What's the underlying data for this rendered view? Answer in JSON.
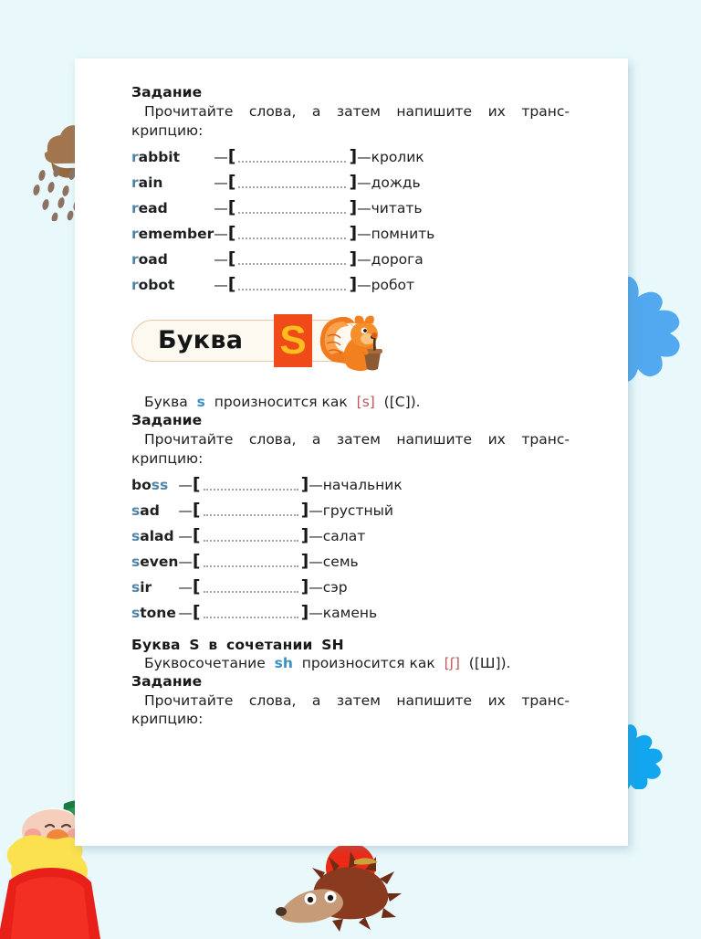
{
  "page": {
    "background_color": "#e8f8fb",
    "sheet_color": "#ffffff"
  },
  "colors": {
    "highlight_blue": "#4d84a8",
    "prose_blue": "#3c91c4",
    "ipa_red": "#c0575b",
    "chip_orange": "#ef4a18",
    "chip_letter": "#fbbe1e",
    "banner_fill": "#fdf9f0",
    "banner_border": "#e6c9a8"
  },
  "section_r": {
    "task_heading": "Задание",
    "instruction_line1": "Прочитайте слова, а затем напишите их транс-",
    "instruction_line2": "крипцию:",
    "words": [
      {
        "prefix": "r",
        "rest": "abbit",
        "dash": "—",
        "blank": "",
        "dash2": "—",
        "translation": "кролик"
      },
      {
        "prefix": "r",
        "rest": "ain",
        "dash": "—",
        "blank": "",
        "dash2": "—",
        "translation": "дождь"
      },
      {
        "prefix": "r",
        "rest": "ead",
        "dash": "—",
        "blank": "",
        "dash2": "—",
        "translation": "читать"
      },
      {
        "prefix": "r",
        "rest": "emember",
        "dash": "—",
        "blank": "",
        "dash2": "—",
        "translation": "помнить"
      },
      {
        "prefix": "r",
        "rest": "oad",
        "dash": "—",
        "blank": "",
        "dash2": "—",
        "translation": "дорога"
      },
      {
        "prefix": "r",
        "rest": "obot",
        "dash": "—",
        "blank": "",
        "dash2": "—",
        "translation": "робот"
      }
    ]
  },
  "banner": {
    "word": "Буква",
    "letter": "S",
    "squirrel_icon": "squirrel-icon"
  },
  "section_s": {
    "rule_prefix": "Буква",
    "rule_letter": "s",
    "rule_middle": "произносится  как",
    "rule_ipa": "[s]",
    "rule_suffix": "([C]).",
    "task_heading": "Задание",
    "instruction_line1": "Прочитайте слова, а затем напишите их транс-",
    "instruction_line2": "крипцию:",
    "words": [
      {
        "prefix": "bo",
        "rest": "ss",
        "highlight_at_end": true,
        "dash": "—",
        "blank": "",
        "dash2": "—",
        "translation": "начальник"
      },
      {
        "prefix": "s",
        "rest": "ad",
        "highlight_at_end": false,
        "dash": "—",
        "blank": "",
        "dash2": "—",
        "translation": "грустный"
      },
      {
        "prefix": "s",
        "rest": "alad",
        "highlight_at_end": false,
        "dash": "—",
        "blank": "",
        "dash2": "—",
        "translation": "салат"
      },
      {
        "prefix": "s",
        "rest": "even",
        "highlight_at_end": false,
        "dash": "—",
        "blank": "",
        "dash2": "—",
        "translation": "семь"
      },
      {
        "prefix": "s",
        "rest": "ir",
        "highlight_at_end": false,
        "dash": "—",
        "blank": "",
        "dash2": "—",
        "translation": "сэр"
      },
      {
        "prefix": "s",
        "rest": "tone",
        "highlight_at_end": false,
        "dash": "—",
        "blank": "",
        "dash2": "—",
        "translation": "камень"
      }
    ]
  },
  "section_sh": {
    "heading_a": "Буква",
    "heading_b": "S",
    "heading_c": "в",
    "heading_d": "сочетании",
    "heading_e": "SH",
    "rule_prefix": "Буквосочетание",
    "rule_letters": "sh",
    "rule_middle": "произносится  как",
    "rule_ipa": "[ʃ]",
    "rule_suffix": "([Ш]).",
    "task_heading": "Задание",
    "instruction_line1": "Прочитайте слова, а затем напишите их транс-",
    "instruction_line2": "крипцию:"
  },
  "decorations": {
    "rain_cloud": "rain-cloud-icon",
    "blob_large": "blue-flower-blob-icon",
    "blob_small": "blue-flower-blob-small-icon",
    "gnome": "gnome-character-icon",
    "hedgehog": "hedgehog-with-apple-icon"
  }
}
